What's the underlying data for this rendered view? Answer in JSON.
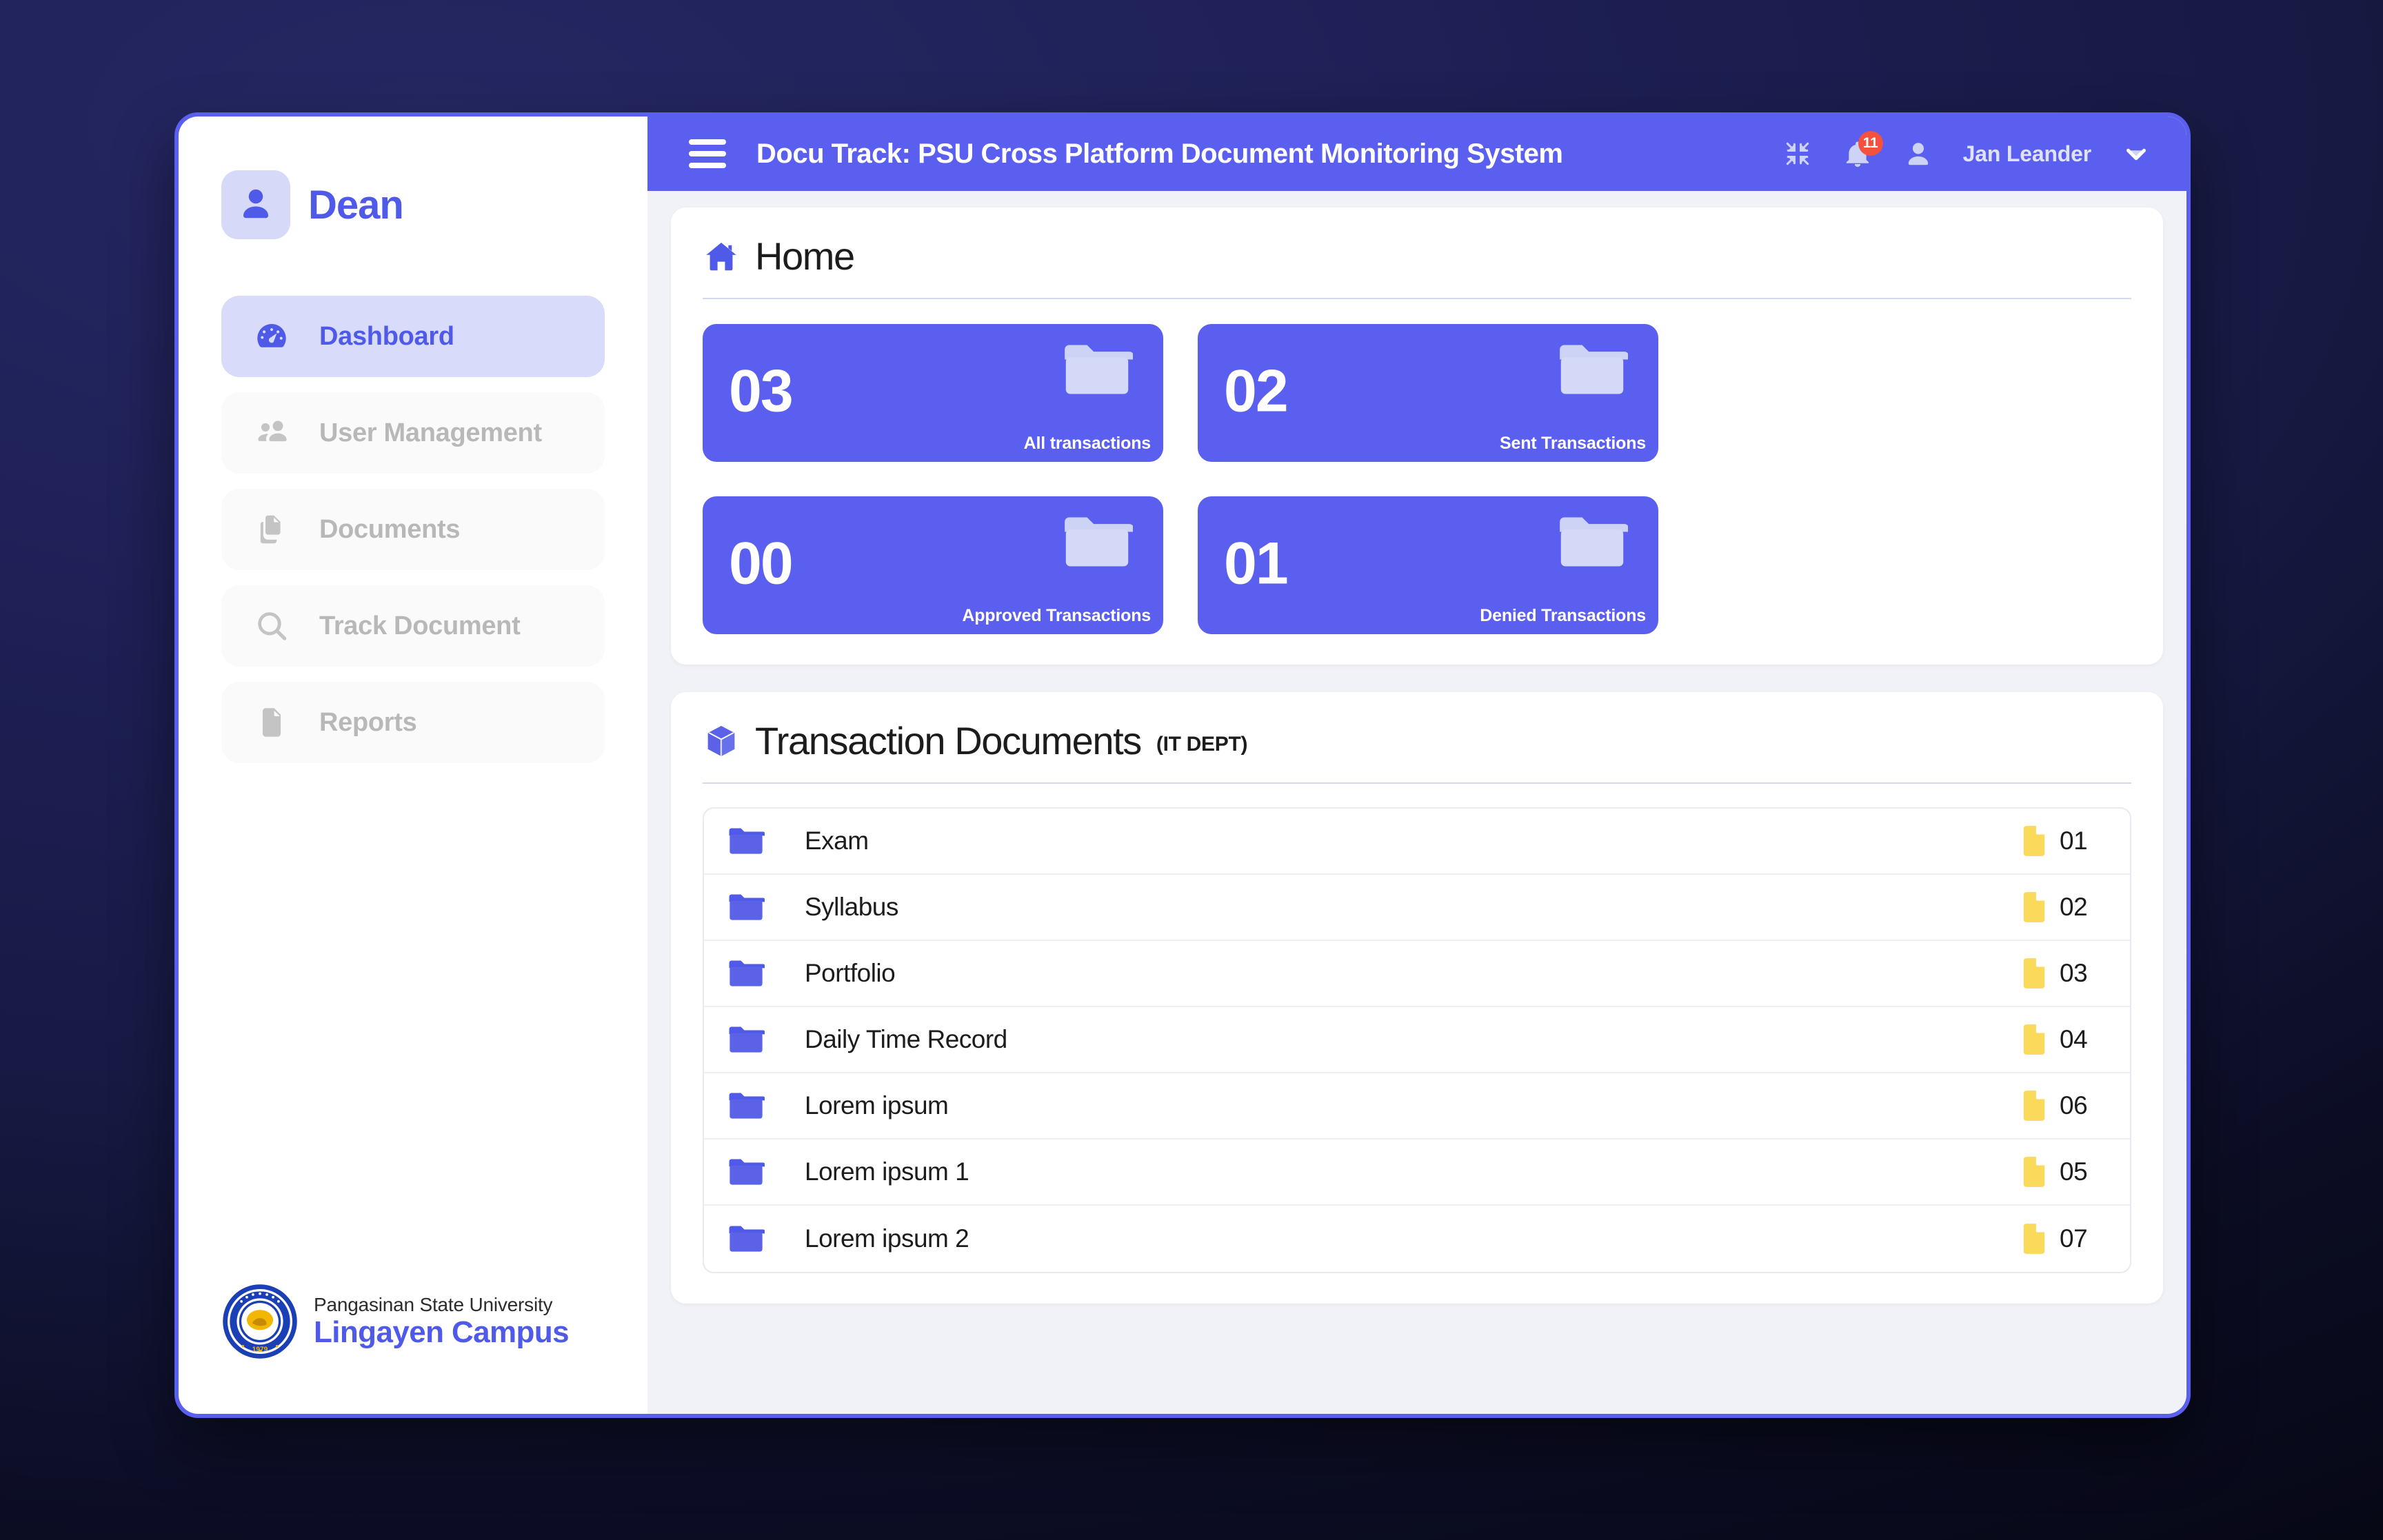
{
  "colors": {
    "accent": "#5B5FEF",
    "accent_dark": "#4F5AE8",
    "badge": "#F4523F",
    "folder_yellow": "#FAD95B",
    "main_bg": "#F1F2F7",
    "page_bg": "#1E2056"
  },
  "sidebar": {
    "brand": {
      "label": "Dean",
      "icon": "user-icon"
    },
    "items": [
      {
        "label": "Dashboard",
        "icon": "dashboard-icon",
        "active": true
      },
      {
        "label": "User Management",
        "icon": "users-icon",
        "active": false
      },
      {
        "label": "Documents",
        "icon": "documents-icon",
        "active": false
      },
      {
        "label": "Track Document",
        "icon": "search-icon",
        "active": false
      },
      {
        "label": "Reports",
        "icon": "file-icon",
        "active": false
      }
    ],
    "footer": {
      "university": "Pangasinan State University",
      "campus": "Lingayen Campus",
      "seal_text": "PANGASINAN STATE UNIVERSITY 1979"
    }
  },
  "topbar": {
    "menu_icon": "hamburger-icon",
    "title": "Docu Track: PSU Cross Platform Document Monitoring System",
    "collapse_icon": "collapse-icon",
    "bell_icon": "bell-icon",
    "notification_count": "11",
    "avatar_icon": "user-icon",
    "user_name": "Jan Leander",
    "chevron_icon": "chevron-down-icon"
  },
  "home_panel": {
    "icon": "home-icon",
    "title": "Home",
    "stats": [
      {
        "value": "03",
        "label": "All transactions",
        "icon": "folder-icon"
      },
      {
        "value": "02",
        "label": "Sent Transactions",
        "icon": "folder-icon"
      },
      {
        "value": "00",
        "label": "Approved Transactions",
        "icon": "folder-icon"
      },
      {
        "value": "01",
        "label": "Denied Transactions",
        "icon": "folder-icon"
      }
    ]
  },
  "transactions_panel": {
    "icon": "cube-icon",
    "title": "Transaction Documents",
    "subtitle": "(IT DEPT)",
    "rows": [
      {
        "name": "Exam",
        "count": "01",
        "folder_icon": "folder-icon",
        "file_icon": "file-icon"
      },
      {
        "name": "Syllabus",
        "count": "02",
        "folder_icon": "folder-icon",
        "file_icon": "file-icon"
      },
      {
        "name": "Portfolio",
        "count": "03",
        "folder_icon": "folder-icon",
        "file_icon": "file-icon"
      },
      {
        "name": "Daily Time Record",
        "count": "04",
        "folder_icon": "folder-icon",
        "file_icon": "file-icon"
      },
      {
        "name": "Lorem ipsum",
        "count": "06",
        "folder_icon": "folder-icon",
        "file_icon": "file-icon"
      },
      {
        "name": "Lorem ipsum 1",
        "count": "05",
        "folder_icon": "folder-icon",
        "file_icon": "file-icon"
      },
      {
        "name": "Lorem ipsum 2",
        "count": "07",
        "folder_icon": "folder-icon",
        "file_icon": "file-icon"
      }
    ]
  }
}
